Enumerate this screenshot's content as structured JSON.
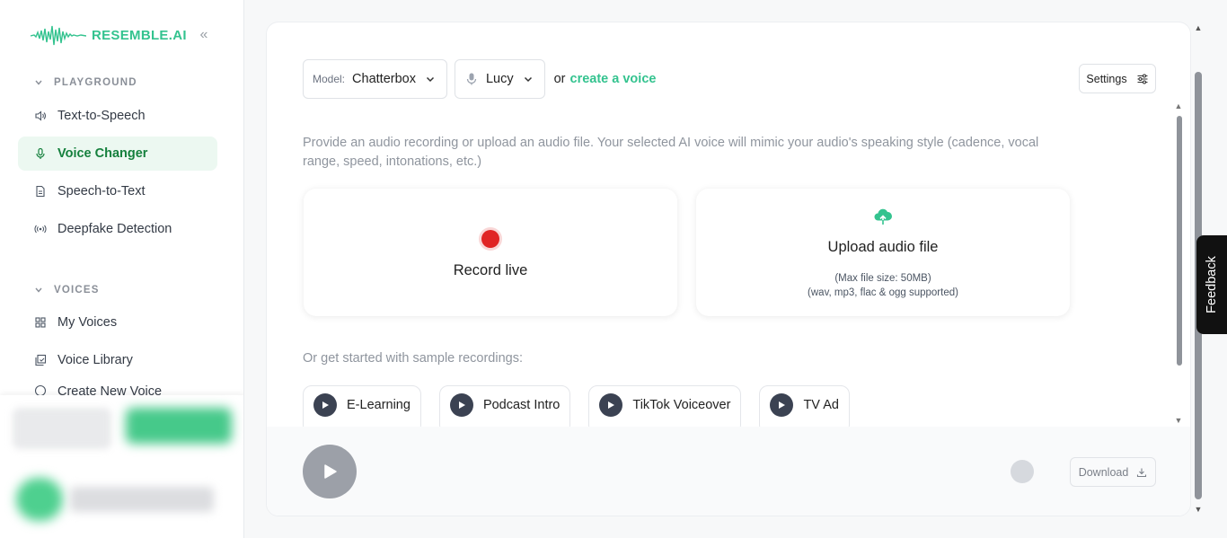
{
  "brand": {
    "name": "RESEMBLE.AI",
    "accent": "#34c38f"
  },
  "sidebar": {
    "sections": [
      {
        "title": "PLAYGROUND",
        "items": [
          {
            "label": "Text-to-Speech",
            "icon": "speaker-icon"
          },
          {
            "label": "Voice Changer",
            "icon": "microphone-icon",
            "active": true
          },
          {
            "label": "Speech-to-Text",
            "icon": "document-icon"
          },
          {
            "label": "Deepfake Detection",
            "icon": "broadcast-icon"
          }
        ]
      },
      {
        "title": "VOICES",
        "items": [
          {
            "label": "My Voices",
            "icon": "grid-icon"
          },
          {
            "label": "Voice Library",
            "icon": "library-icon"
          },
          {
            "label": "Create New Voice",
            "icon": "plus-circle-icon"
          }
        ]
      }
    ]
  },
  "toolbar": {
    "model_label": "Model:",
    "model_value": "Chatterbox",
    "voice_value": "Lucy",
    "or_text": "or",
    "create_link": "create a voice",
    "settings_label": "Settings"
  },
  "main": {
    "description": "Provide an audio recording or upload an audio file. Your selected AI voice will mimic your audio's speaking style (cadence, vocal range, speed, intonations, etc.)",
    "record_label": "Record live",
    "upload_label": "Upload audio file",
    "upload_size": "(Max file size: 50MB)",
    "upload_formats": "(wav, mp3, flac & ogg supported)",
    "samples_heading": "Or get started with sample recordings:",
    "samples": [
      "E-Learning",
      "Podcast Intro",
      "TikTok Voiceover",
      "TV Ad"
    ]
  },
  "player": {
    "download_label": "Download"
  },
  "feedback": {
    "label": "Feedback"
  }
}
